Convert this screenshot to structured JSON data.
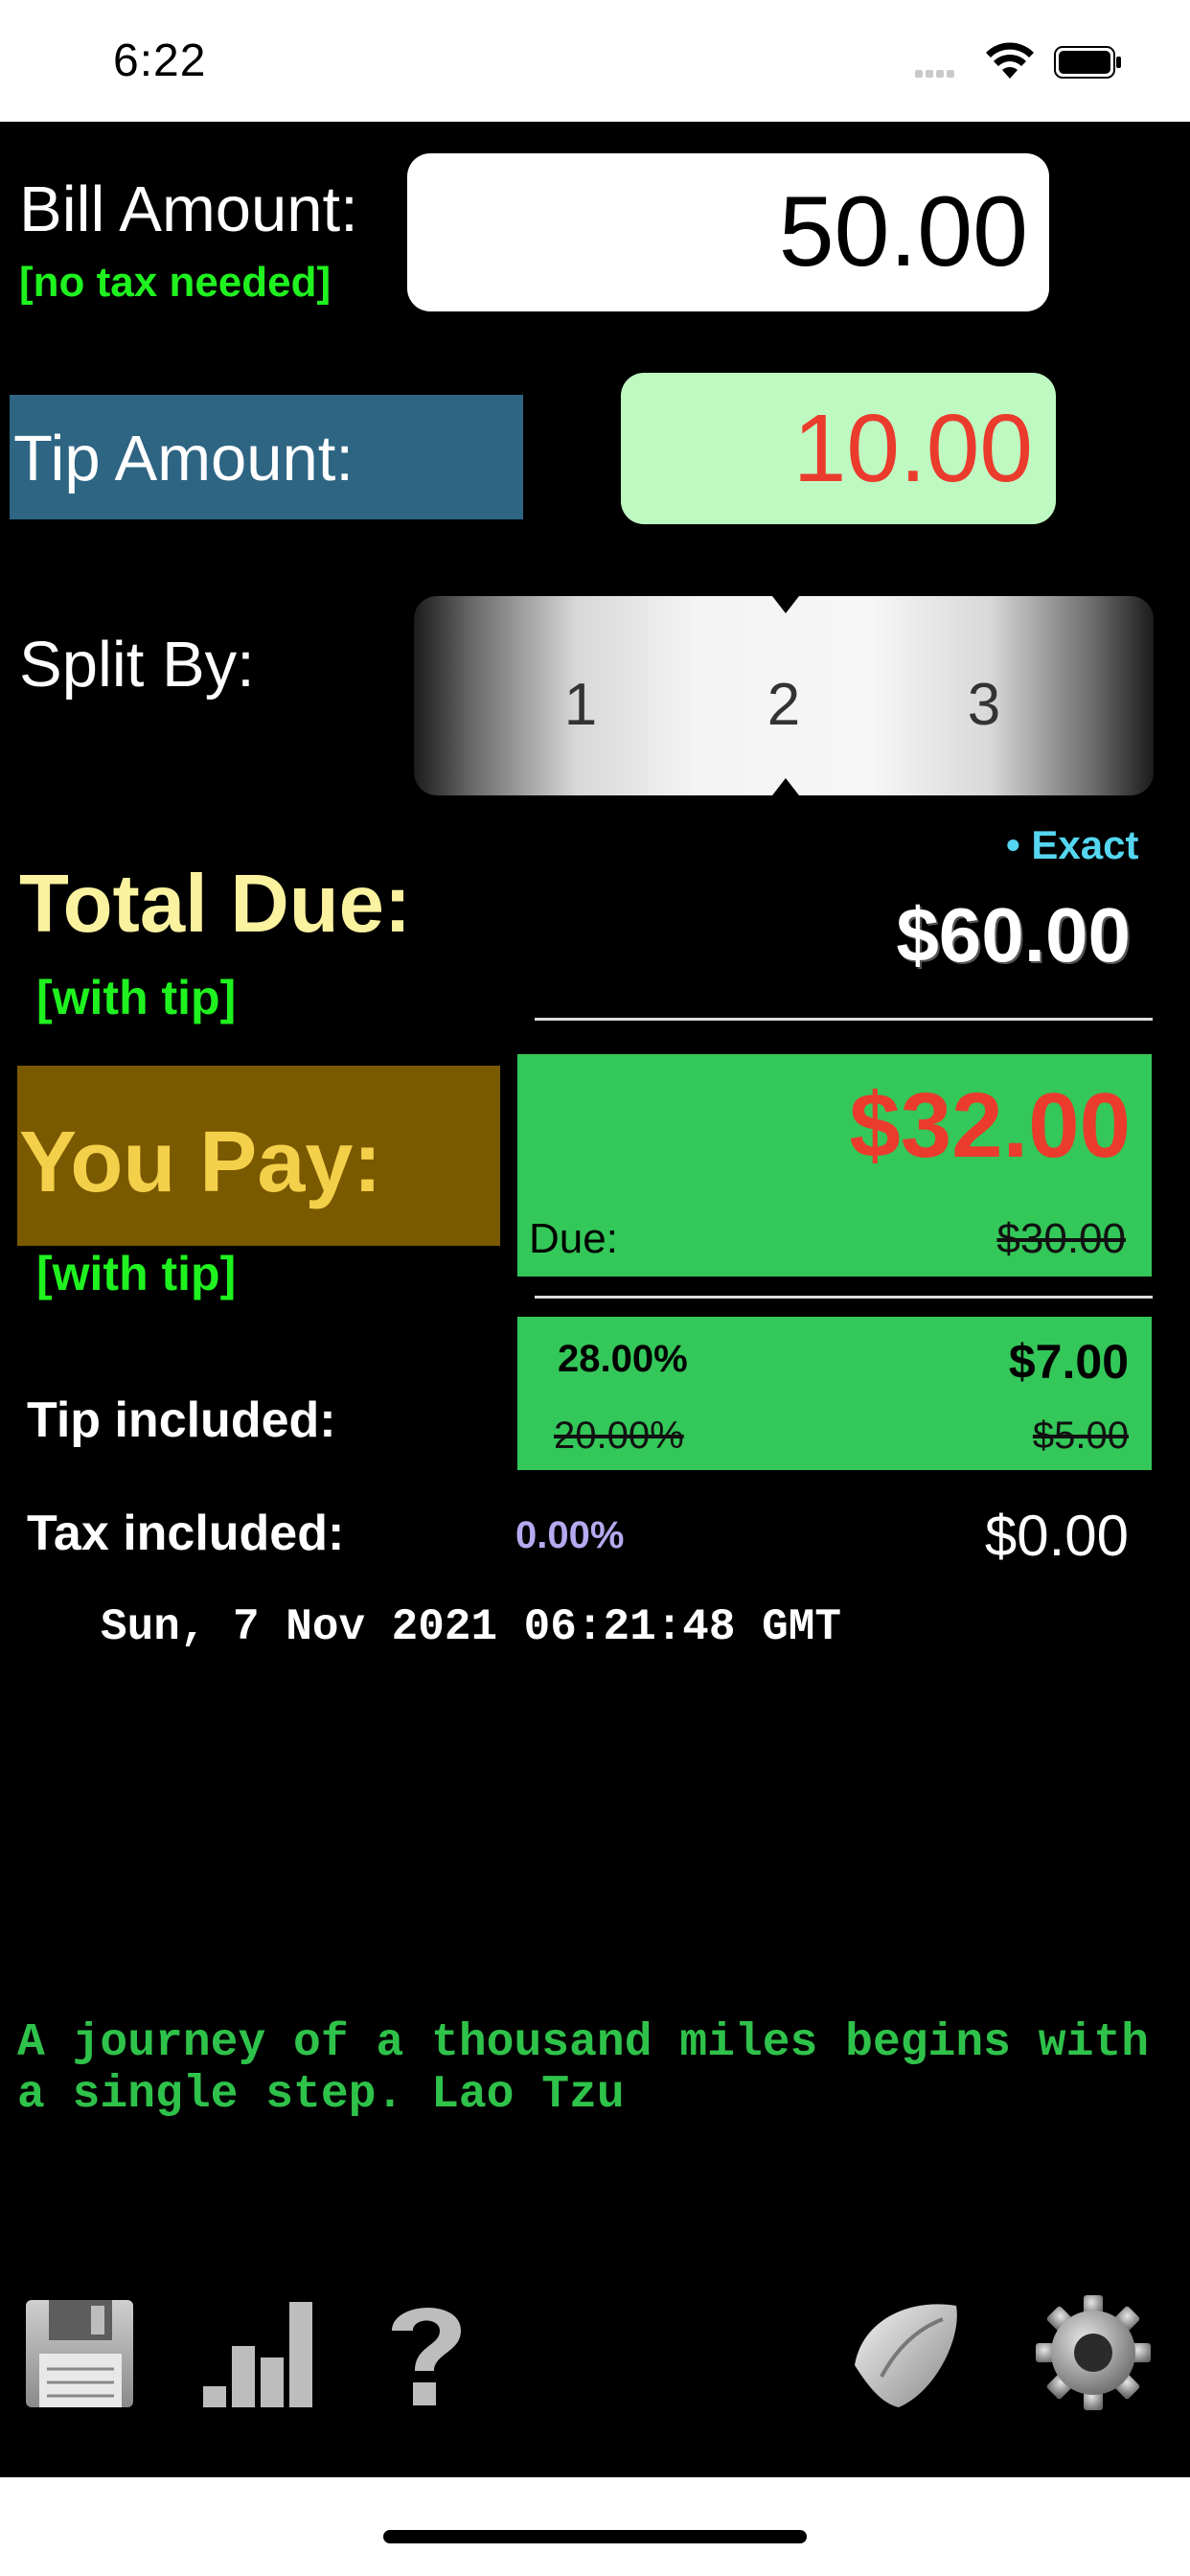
{
  "status_bar": {
    "time": "6:22"
  },
  "bill": {
    "label": "Bill Amount:",
    "note": "[no tax needed]",
    "value": "50.00"
  },
  "tip": {
    "label": "Tip Amount:",
    "value": "10.00"
  },
  "split": {
    "label": "Split By:",
    "options": [
      "1",
      "2",
      "3"
    ],
    "selected": "2"
  },
  "exact_label": "• Exact",
  "total": {
    "label": "Total Due:",
    "note": "[with tip]",
    "value": "$60.00"
  },
  "you_pay": {
    "label": "You Pay:",
    "note": "[with tip]",
    "value": "$32.00",
    "due_label": "Due:",
    "due_value": "$30.00"
  },
  "tip_included": {
    "label": "Tip included:",
    "pct": "28.00%",
    "amount": "$7.00",
    "orig_pct": "20.00%",
    "orig_amount": "$5.00"
  },
  "tax_included": {
    "label": "Tax included:",
    "pct": "0.00%",
    "amount": "$0.00"
  },
  "datetime": "Sun, 7 Nov 2021 06:21:48 GMT",
  "quote": "A journey of a thousand miles begins with a single step. Lao Tzu",
  "toolbar": {
    "icons": [
      "save-icon",
      "stats-icon",
      "help-icon",
      "fortune-cookie-icon",
      "settings-icon"
    ]
  },
  "colors": {
    "tip_label_bg": "#2d6583",
    "pay_label_bg": "#7a5a00",
    "green_box": "#34c759",
    "tip_input_bg": "#bff9c2",
    "alert_red": "#ea3b2c"
  }
}
